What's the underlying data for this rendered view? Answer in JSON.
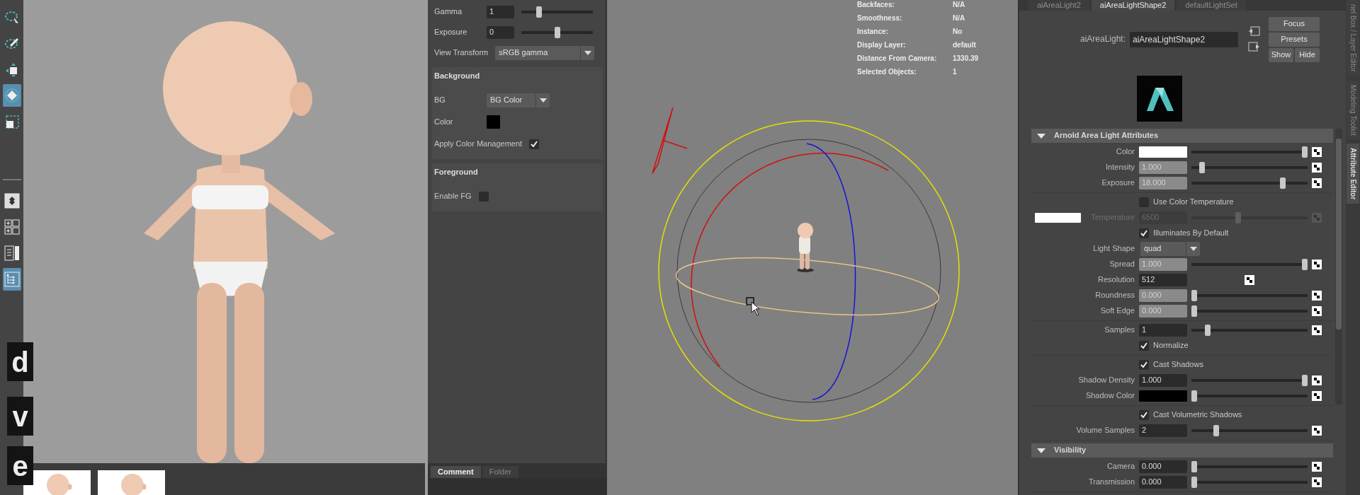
{
  "toolbar": {
    "tools": [
      {
        "kind": "lasso",
        "selected": false
      },
      {
        "kind": "paint",
        "selected": false
      },
      {
        "kind": "move",
        "selected": false
      },
      {
        "kind": "rotate",
        "selected": true
      },
      {
        "kind": "scale",
        "selected": false
      }
    ],
    "layouts": [
      {
        "kind": "single",
        "selected": false
      },
      {
        "kind": "quad",
        "selected": false
      },
      {
        "kind": "split",
        "selected": false
      },
      {
        "kind": "outliner",
        "selected": true
      }
    ]
  },
  "key_overlays": [
    "d",
    "v",
    "e"
  ],
  "thumbnails": [
    {
      "kind": "picture"
    },
    {
      "kind": "picture"
    }
  ],
  "display_panel": {
    "rows": [
      {
        "kind": "slider",
        "label": "Gamma",
        "value": "1",
        "level": 0.23
      },
      {
        "kind": "slider",
        "label": "Exposure",
        "value": "0",
        "level": 0.5
      },
      {
        "kind": "dropdown",
        "label": "View Transform",
        "value": "sRGB gamma"
      }
    ],
    "sections": [
      {
        "title": "Background",
        "rows": [
          {
            "kind": "dropdown",
            "label": "BG",
            "value": "BG Color"
          },
          {
            "kind": "color",
            "label": "Color",
            "color": "#000000"
          },
          {
            "kind": "checkbox",
            "label": "Apply Color Management",
            "checked": true
          }
        ]
      },
      {
        "title": "Foreground",
        "rows": [
          {
            "kind": "checkbox",
            "label": "Enable FG",
            "checked": false
          }
        ]
      }
    ],
    "tabs": [
      {
        "label": "Comment",
        "selected": true
      },
      {
        "label": "Folder",
        "selected": false
      }
    ]
  },
  "viewport": {
    "hud": [
      {
        "label": "Backfaces:",
        "value": "N/A"
      },
      {
        "label": "Smoothness:",
        "value": "N/A"
      },
      {
        "label": "Instance:",
        "value": "No"
      },
      {
        "label": "Display Layer:",
        "value": "default"
      },
      {
        "label": "Distance From Camera:",
        "value": "1330.39"
      },
      {
        "label": "Selected Objects:",
        "value": "1"
      }
    ]
  },
  "attribute_editor": {
    "tabs": [
      {
        "label": "aiAreaLight2",
        "selected": false
      },
      {
        "label": "aiAreaLightShape2",
        "selected": true
      },
      {
        "label": "defaultLightSet",
        "selected": false
      }
    ],
    "node_label": "aiAreaLight:",
    "node_name": "aiAreaLightShape2",
    "buttons": [
      "Focus",
      "Presets",
      "Show",
      "Hide"
    ],
    "sections": [
      {
        "title": "Arnold Area Light Attributes",
        "expanded": true,
        "groups": [
          {
            "rows": [
              {
                "kind": "color",
                "label": "Color",
                "color": "#ffffff",
                "level": 1
              },
              {
                "kind": "slider",
                "label": "Intensity",
                "value": "1.000",
                "level": 0.07,
                "dimmed": true
              },
              {
                "kind": "slider",
                "label": "Exposure",
                "value": "18.000",
                "level": 0.8,
                "dimmed": true
              }
            ]
          },
          {
            "rows": [
              {
                "kind": "checkbox",
                "label": "Use Color Temperature",
                "checked": false
              },
              {
                "kind": "temperature",
                "label": "Temperature",
                "value": "6500",
                "color": "#ffffff",
                "level": 0.4,
                "disabled": true
              },
              {
                "kind": "checkbox",
                "label": "Illuminates By Default",
                "checked": true
              },
              {
                "kind": "dropdown",
                "label": "Light Shape",
                "value": "quad"
              },
              {
                "kind": "slider",
                "label": "Spread",
                "value": "1.000",
                "level": 1,
                "dimmed": true
              },
              {
                "kind": "field",
                "label": "Resolution",
                "value": "512"
              },
              {
                "kind": "slider",
                "label": "Roundness",
                "value": "0.000",
                "level": 0,
                "dimmed": true
              },
              {
                "kind": "slider",
                "label": "Soft Edge",
                "value": "0.000",
                "level": 0,
                "dimmed": true
              }
            ]
          },
          {
            "rows": [
              {
                "kind": "slider",
                "label": "Samples",
                "value": "1",
                "level": 0.12,
                "dimmed": false
              },
              {
                "kind": "checkbox",
                "label": "Normalize",
                "checked": true
              }
            ]
          },
          {
            "rows": [
              {
                "kind": "checkbox",
                "label": "Cast Shadows",
                "checked": true
              },
              {
                "kind": "slider",
                "label": "Shadow Density",
                "value": "1.000",
                "level": 1,
                "dimmed": false
              },
              {
                "kind": "color",
                "label": "Shadow Color",
                "color": "#000000",
                "level": 0
              }
            ]
          },
          {
            "rows": [
              {
                "kind": "checkbox",
                "label": "Cast Volumetric Shadows",
                "checked": true
              },
              {
                "kind": "slider",
                "label": "Volume Samples",
                "value": "2",
                "level": 0.2,
                "dimmed": false
              }
            ]
          }
        ]
      },
      {
        "title": "Visibility",
        "expanded": true,
        "groups": [
          {
            "rows": [
              {
                "kind": "slider",
                "label": "Camera",
                "value": "0.000",
                "level": 0,
                "dimmed": false
              },
              {
                "kind": "slider",
                "label": "Transmission",
                "value": "0.000",
                "level": 0,
                "dimmed": false
              }
            ]
          }
        ]
      }
    ]
  },
  "side_tabs": [
    {
      "label": "nel Box / Layer Editor",
      "selected": false
    },
    {
      "label": "Modeling Toolkit",
      "selected": false
    },
    {
      "label": "Attribute Editor",
      "selected": true
    }
  ]
}
